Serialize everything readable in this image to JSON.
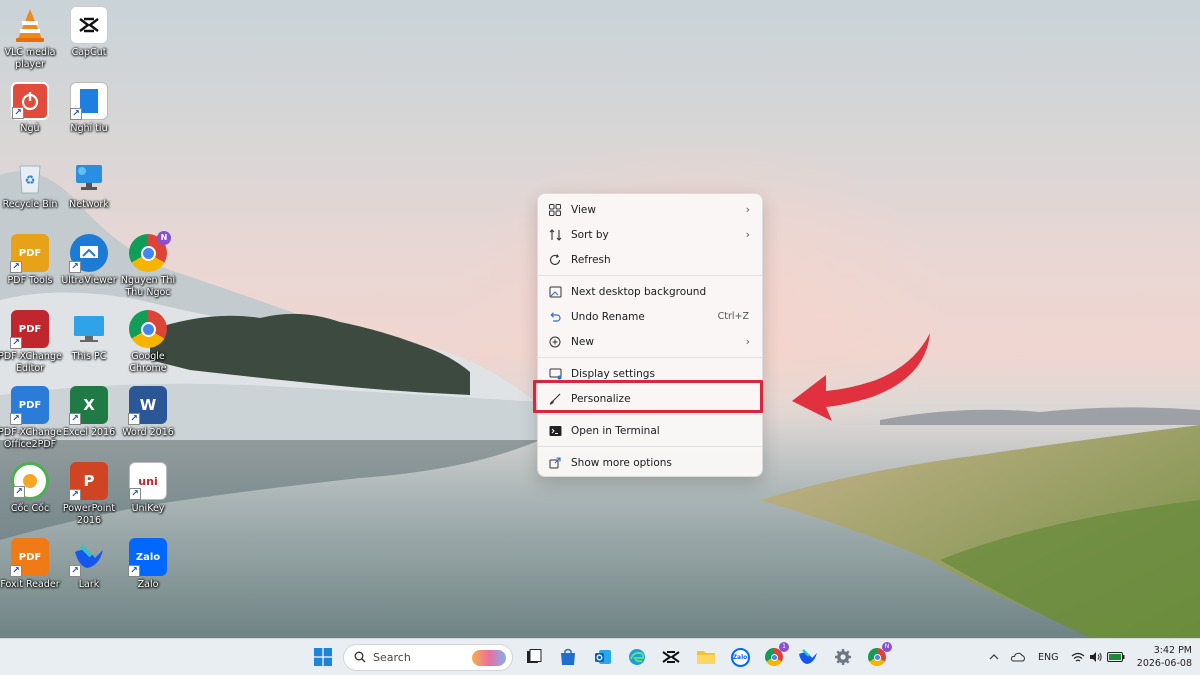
{
  "desktop_icons": [
    {
      "label": "VLC media player"
    },
    {
      "label": "CapCut"
    },
    {
      "label": "Ngủ"
    },
    {
      "label": "Nghỉ tiu"
    },
    {
      "label": "Recycle Bin"
    },
    {
      "label": "Network"
    },
    {
      "label": "PDF Tools"
    },
    {
      "label": "UltraViewer"
    },
    {
      "label": "Nguyen Thi Thu Ngoc"
    },
    {
      "label": "PDF-XChange Editor"
    },
    {
      "label": "This PC"
    },
    {
      "label": "Google Chrome"
    },
    {
      "label": "PDF-XChange Office2PDF"
    },
    {
      "label": "Excel 2016"
    },
    {
      "label": "Word 2016"
    },
    {
      "label": "Cốc Cốc"
    },
    {
      "label": "PowerPoint 2016"
    },
    {
      "label": "UniKey"
    },
    {
      "label": "Foxit Reader"
    },
    {
      "label": "Lark"
    },
    {
      "label": "Zalo"
    }
  ],
  "context_menu": {
    "items": [
      {
        "label": "View",
        "icon": "grid-icon",
        "submenu": true
      },
      {
        "label": "Sort by",
        "icon": "sort-icon",
        "submenu": true
      },
      {
        "label": "Refresh",
        "icon": "refresh-icon"
      },
      {
        "label": "Next desktop background",
        "icon": "next-background-icon"
      },
      {
        "label": "Undo Rename",
        "icon": "undo-icon",
        "shortcut": "Ctrl+Z"
      },
      {
        "label": "New",
        "icon": "plus-circle-icon",
        "submenu": true
      },
      {
        "label": "Display settings",
        "icon": "display-icon"
      },
      {
        "label": "Personalize",
        "icon": "brush-icon",
        "highlighted": true
      },
      {
        "label": "Open in Terminal",
        "icon": "terminal-icon"
      },
      {
        "label": "Show more options",
        "icon": "external-icon"
      }
    ],
    "highlight_color": "#d7263d",
    "arrow_color": "#e1313f"
  },
  "taskbar": {
    "search_label": "Search",
    "language": "ENG",
    "time": "3:42 PM",
    "date": "2026-06-08",
    "pinned_icons": [
      "windows-start-icon",
      "task-view-icon",
      "store-icon",
      "outlook-icon",
      "edge-icon",
      "capcut-icon",
      "file-explorer-icon",
      "zalo-icon",
      "chrome-icon",
      "lark-icon",
      "settings-icon",
      "chrome-profile-icon"
    ]
  }
}
